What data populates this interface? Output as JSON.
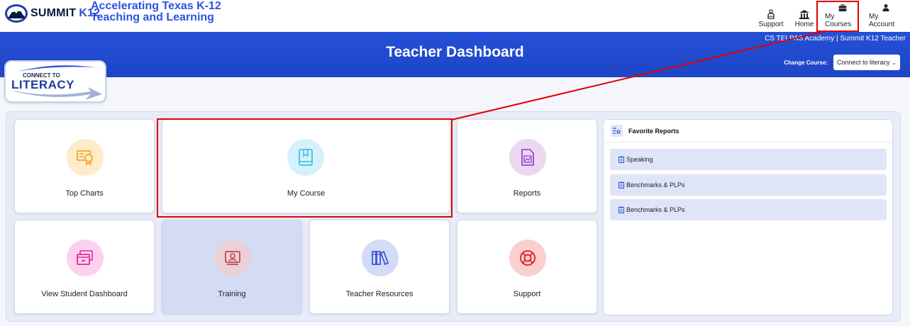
{
  "header": {
    "brand_word": "SUMMIT",
    "brand_k12": "K12",
    "tagline_line1": "Accelerating Texas K-12",
    "tagline_line2": "Teaching and Learning",
    "nav": [
      {
        "label": "Support",
        "icon": "support-person-icon"
      },
      {
        "label": "Home",
        "icon": "home-building-icon"
      },
      {
        "label": "My Courses",
        "icon": "briefcase-icon"
      },
      {
        "label": "My Account",
        "icon": "user-icon"
      }
    ]
  },
  "band": {
    "title": "Teacher Dashboard",
    "org_line": "CS TELPAS Academy | Summit K12 Teacher",
    "change_course_label": "Change Course:",
    "course_selected": "Connect to literacy"
  },
  "badge": {
    "top_text": "CONNECT TO",
    "main_text": "LITERACY"
  },
  "cards": [
    {
      "label": "Top Charts",
      "icon": "certificate-chart-icon",
      "color": "#f5a623"
    },
    {
      "label": "My Course",
      "icon": "book-icon",
      "color": "#3cc0e6"
    },
    {
      "label": "Reports",
      "icon": "report-document-icon",
      "color": "#9b4bc5"
    },
    {
      "label": "View Student Dashboard",
      "icon": "student-dashboard-icon",
      "color": "#e0289a"
    },
    {
      "label": "Training",
      "icon": "training-presenter-icon",
      "color": "#c04a4a"
    },
    {
      "label": "Teacher Resources",
      "icon": "books-icon",
      "color": "#3553c9"
    },
    {
      "label": "Support",
      "icon": "lifebuoy-icon",
      "color": "#e02a2a"
    }
  ],
  "favorites": {
    "title": "Favorite Reports",
    "items": [
      "Speaking",
      "Benchmarks & PLPs",
      "Benchmarks & PLPs"
    ]
  },
  "colors": {
    "brand_blue": "#2450d6",
    "annotation_red": "#e00000",
    "panel_bg": "#e8ecf7"
  }
}
